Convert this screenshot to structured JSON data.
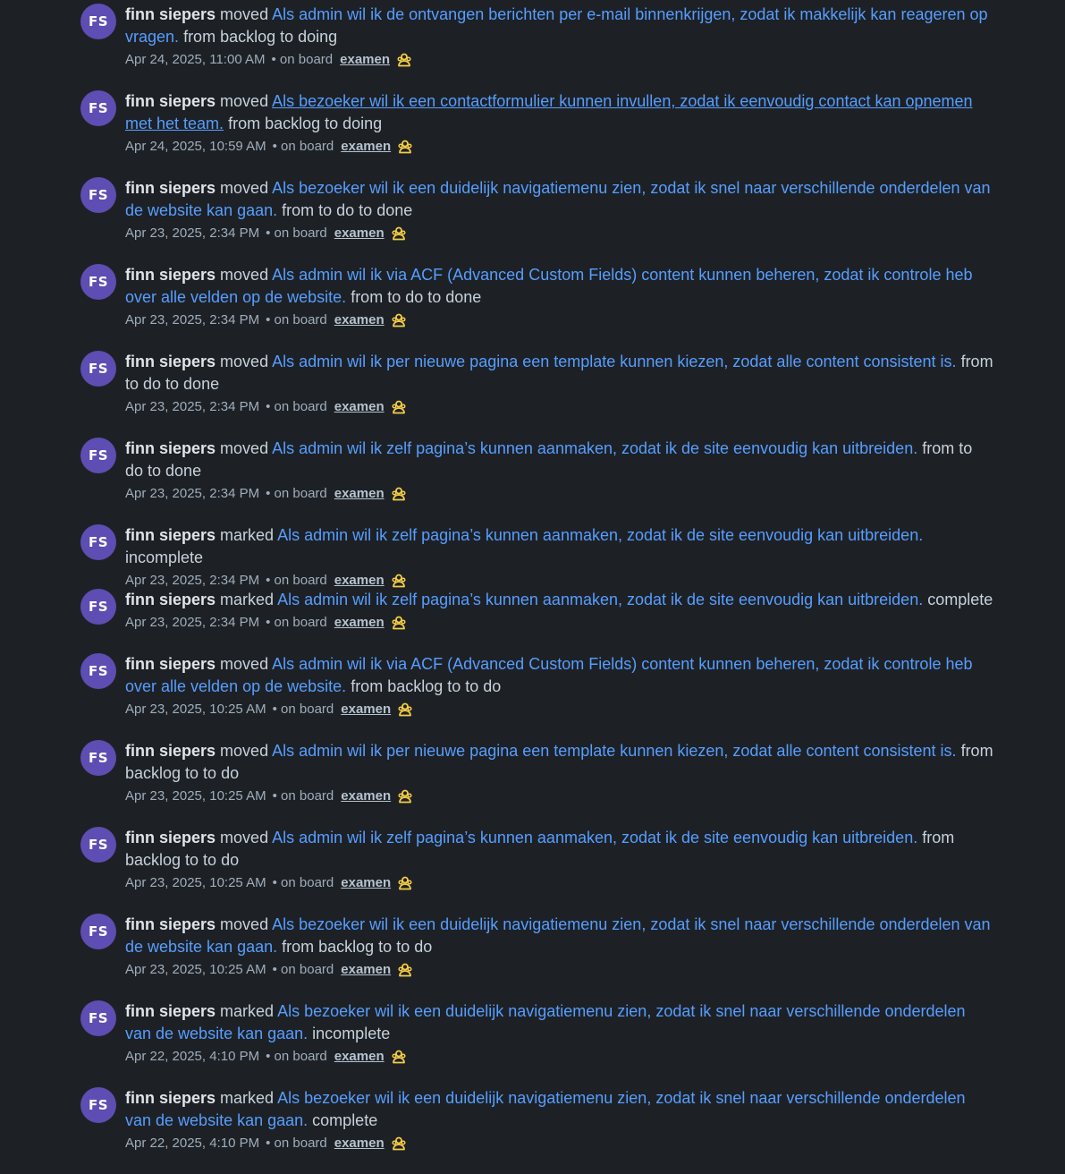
{
  "feed": {
    "entries": [
      {
        "initials": "FS",
        "user": "finn siepers",
        "action": "moved",
        "card": "Als admin wil ik de ontvangen berichten per e-mail binnenkrijgen, zodat ik makkelijk kan reageren op vragen.",
        "detail": "from backlog to doing",
        "timestamp": "Apr 24, 2025, 11:00 AM",
        "board_prefix": "• on board",
        "board": "examen"
      },
      {
        "initials": "FS",
        "user": "finn siepers",
        "action": "moved",
        "card": "Als bezoeker wil ik een contactformulier kunnen invullen, zodat ik eenvoudig contact kan opnemen met het team.",
        "detail": "from backlog to doing",
        "timestamp": "Apr 24, 2025, 10:59 AM",
        "board_prefix": "• on board",
        "board": "examen"
      },
      {
        "initials": "FS",
        "user": "finn siepers",
        "action": "moved",
        "card": "Als bezoeker wil ik een duidelijk navigatiemenu zien, zodat ik snel naar verschillende onderdelen van de website kan gaan.",
        "detail": "from to do to done",
        "timestamp": "Apr 23, 2025, 2:34 PM",
        "board_prefix": "• on board",
        "board": "examen"
      },
      {
        "initials": "FS",
        "user": "finn siepers",
        "action": "moved",
        "card": "Als admin wil ik via ACF (Advanced Custom Fields) content kunnen beheren, zodat ik controle heb over alle velden op de website.",
        "detail": "from to do to done",
        "timestamp": "Apr 23, 2025, 2:34 PM",
        "board_prefix": "• on board",
        "board": "examen"
      },
      {
        "initials": "FS",
        "user": "finn siepers",
        "action": "moved",
        "card": "Als admin wil ik per nieuwe pagina een template kunnen kiezen, zodat alle content consistent is.",
        "detail": "from to do to done",
        "timestamp": "Apr 23, 2025, 2:34 PM",
        "board_prefix": "• on board",
        "board": "examen"
      },
      {
        "initials": "FS",
        "user": "finn siepers",
        "action": "moved",
        "card": "Als admin wil ik zelf pagina’s kunnen aanmaken, zodat ik de site eenvoudig kan uitbreiden.",
        "detail": "from to do to done",
        "timestamp": "Apr 23, 2025, 2:34 PM",
        "board_prefix": "• on board",
        "board": "examen"
      },
      {
        "initials": "FS",
        "user": "finn siepers",
        "action": "marked",
        "card": "Als admin wil ik zelf pagina’s kunnen aanmaken, zodat ik de site eenvoudig kan uitbreiden.",
        "detail": "incomplete",
        "timestamp": "Apr 23, 2025, 2:34 PM",
        "board_prefix": "• on board",
        "board": "examen"
      },
      {
        "initials": "FS",
        "user": "finn siepers",
        "action": "marked",
        "card": "Als admin wil ik zelf pagina’s kunnen aanmaken, zodat ik de site eenvoudig kan uitbreiden.",
        "detail": "complete",
        "timestamp": "Apr 23, 2025, 2:34 PM",
        "board_prefix": "• on board",
        "board": "examen"
      },
      {
        "initials": "FS",
        "user": "finn siepers",
        "action": "moved",
        "card": "Als admin wil ik via ACF (Advanced Custom Fields) content kunnen beheren, zodat ik controle heb over alle velden op de website.",
        "detail": "from backlog to to do",
        "timestamp": "Apr 23, 2025, 10:25 AM",
        "board_prefix": "• on board",
        "board": "examen"
      },
      {
        "initials": "FS",
        "user": "finn siepers",
        "action": "moved",
        "card": "Als admin wil ik per nieuwe pagina een template kunnen kiezen, zodat alle content consistent is.",
        "detail": "from backlog to to do",
        "timestamp": "Apr 23, 2025, 10:25 AM",
        "board_prefix": "• on board",
        "board": "examen"
      },
      {
        "initials": "FS",
        "user": "finn siepers",
        "action": "moved",
        "card": "Als admin wil ik zelf pagina’s kunnen aanmaken, zodat ik de site eenvoudig kan uitbreiden.",
        "detail": "from backlog to to do",
        "timestamp": "Apr 23, 2025, 10:25 AM",
        "board_prefix": "• on board",
        "board": "examen"
      },
      {
        "initials": "FS",
        "user": "finn siepers",
        "action": "moved",
        "card": "Als bezoeker wil ik een duidelijk navigatiemenu zien, zodat ik snel naar verschillende onderdelen van de website kan gaan.",
        "detail": "from backlog to to do",
        "timestamp": "Apr 23, 2025, 10:25 AM",
        "board_prefix": "• on board",
        "board": "examen"
      },
      {
        "initials": "FS",
        "user": "finn siepers",
        "action": "marked",
        "card": "Als bezoeker wil ik een duidelijk navigatiemenu zien, zodat ik snel naar verschillende onderdelen van de website kan gaan.",
        "detail": "incomplete",
        "timestamp": "Apr 22, 2025, 4:10 PM",
        "board_prefix": "• on board",
        "board": "examen"
      },
      {
        "initials": "FS",
        "user": "finn siepers",
        "action": "marked",
        "card": "Als bezoeker wil ik een duidelijk navigatiemenu zien, zodat ik snel naar verschillende onderdelen van de website kan gaan.",
        "detail": "complete",
        "timestamp": "Apr 22, 2025, 4:10 PM",
        "board_prefix": "• on board",
        "board": "examen"
      }
    ]
  },
  "icons": {
    "board_visibility": "workspace-members-icon"
  },
  "colors": {
    "background": "#1d2125",
    "avatar": "#5e4db2",
    "card_link": "#579dff",
    "icon_accent": "#f5cd47"
  }
}
